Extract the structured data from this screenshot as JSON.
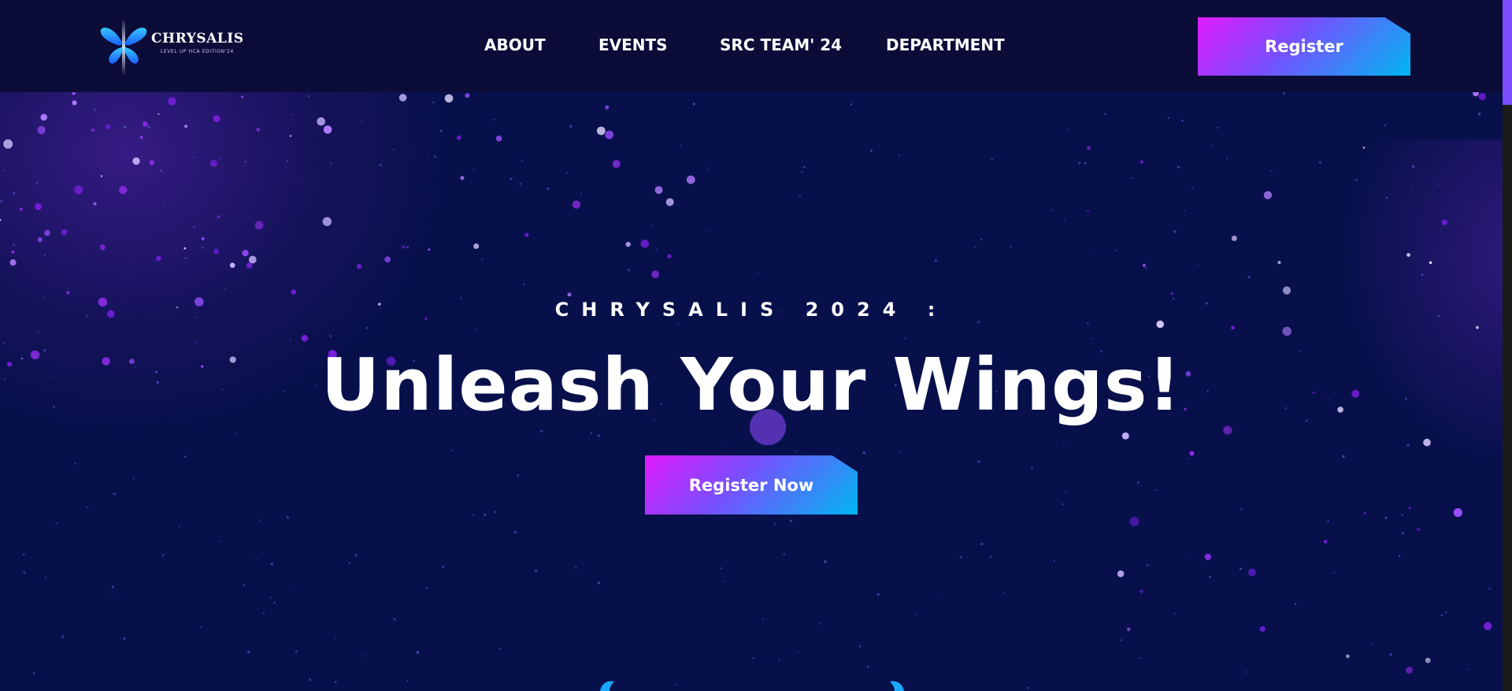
{
  "brand": {
    "name": "CHRYSALIS",
    "tagline": "LEVEL UP HCA EDITION'24",
    "logo_icon": "butterfly-icon"
  },
  "nav": {
    "links": [
      {
        "label": "ABOUT"
      },
      {
        "label": "EVENTS"
      },
      {
        "label": "SRC TEAM' 24"
      },
      {
        "label": "DEPARTMENT"
      }
    ],
    "register_label": "Register"
  },
  "hero": {
    "subtitle": "CHRYSALIS 2024 :",
    "title": "Unleash Your Wings!",
    "cta_label": "Register Now"
  },
  "colors": {
    "nav_background": "#0c0c38",
    "hero_background": "#07104b",
    "button_gradient_start": "#e11bff",
    "button_gradient_end": "#00b7f0",
    "particle_purple": "#8a2be2",
    "scrollbar_thumb": "#7b4dff"
  }
}
